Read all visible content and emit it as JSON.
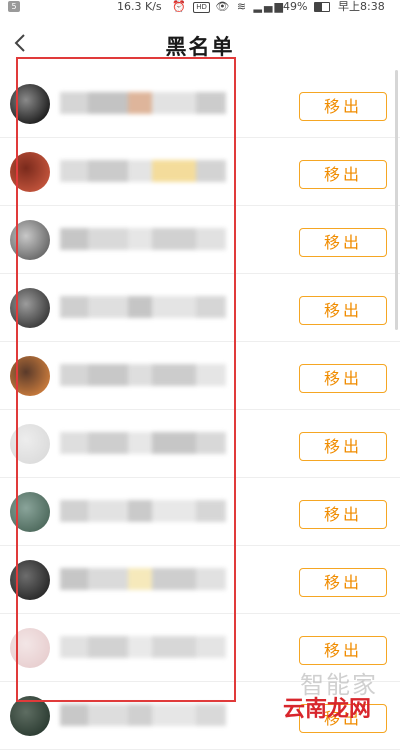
{
  "status_bar": {
    "badge": "5",
    "speed": "16.3 K/s",
    "hd": "HD",
    "battery_pct": "49%",
    "battery_level": 0.49,
    "time": "早上8:38"
  },
  "header": {
    "title": "黑名单"
  },
  "list": {
    "remove_label": "移出",
    "items": [
      {
        "avatar_colors": [
          "#1f1f1f",
          "#8a8a8a"
        ]
      },
      {
        "avatar_colors": [
          "#c1533b",
          "#7a2a1c"
        ]
      },
      {
        "avatar_colors": [
          "#6a6a6a",
          "#c8c8c8"
        ]
      },
      {
        "avatar_colors": [
          "#3c3c3c",
          "#9c9c9c"
        ]
      },
      {
        "avatar_colors": [
          "#c77a3c",
          "#5a3a2a"
        ]
      },
      {
        "avatar_colors": [
          "#dcdcdc",
          "#ededed"
        ]
      },
      {
        "avatar_colors": [
          "#4f6b5e",
          "#8aa49a"
        ]
      },
      {
        "avatar_colors": [
          "#2a2a2a",
          "#6d6d6d"
        ]
      },
      {
        "avatar_colors": [
          "#e8cfd0",
          "#f3e6e6"
        ]
      },
      {
        "avatar_colors": [
          "#2d3d33",
          "#5e6d62"
        ]
      }
    ]
  },
  "watermark": {
    "top_text": "智能家",
    "main_text": "云南龙网"
  },
  "colors": {
    "accent": "#f5a623",
    "accent_text": "#f08c00",
    "highlight": "#e03a3a"
  }
}
